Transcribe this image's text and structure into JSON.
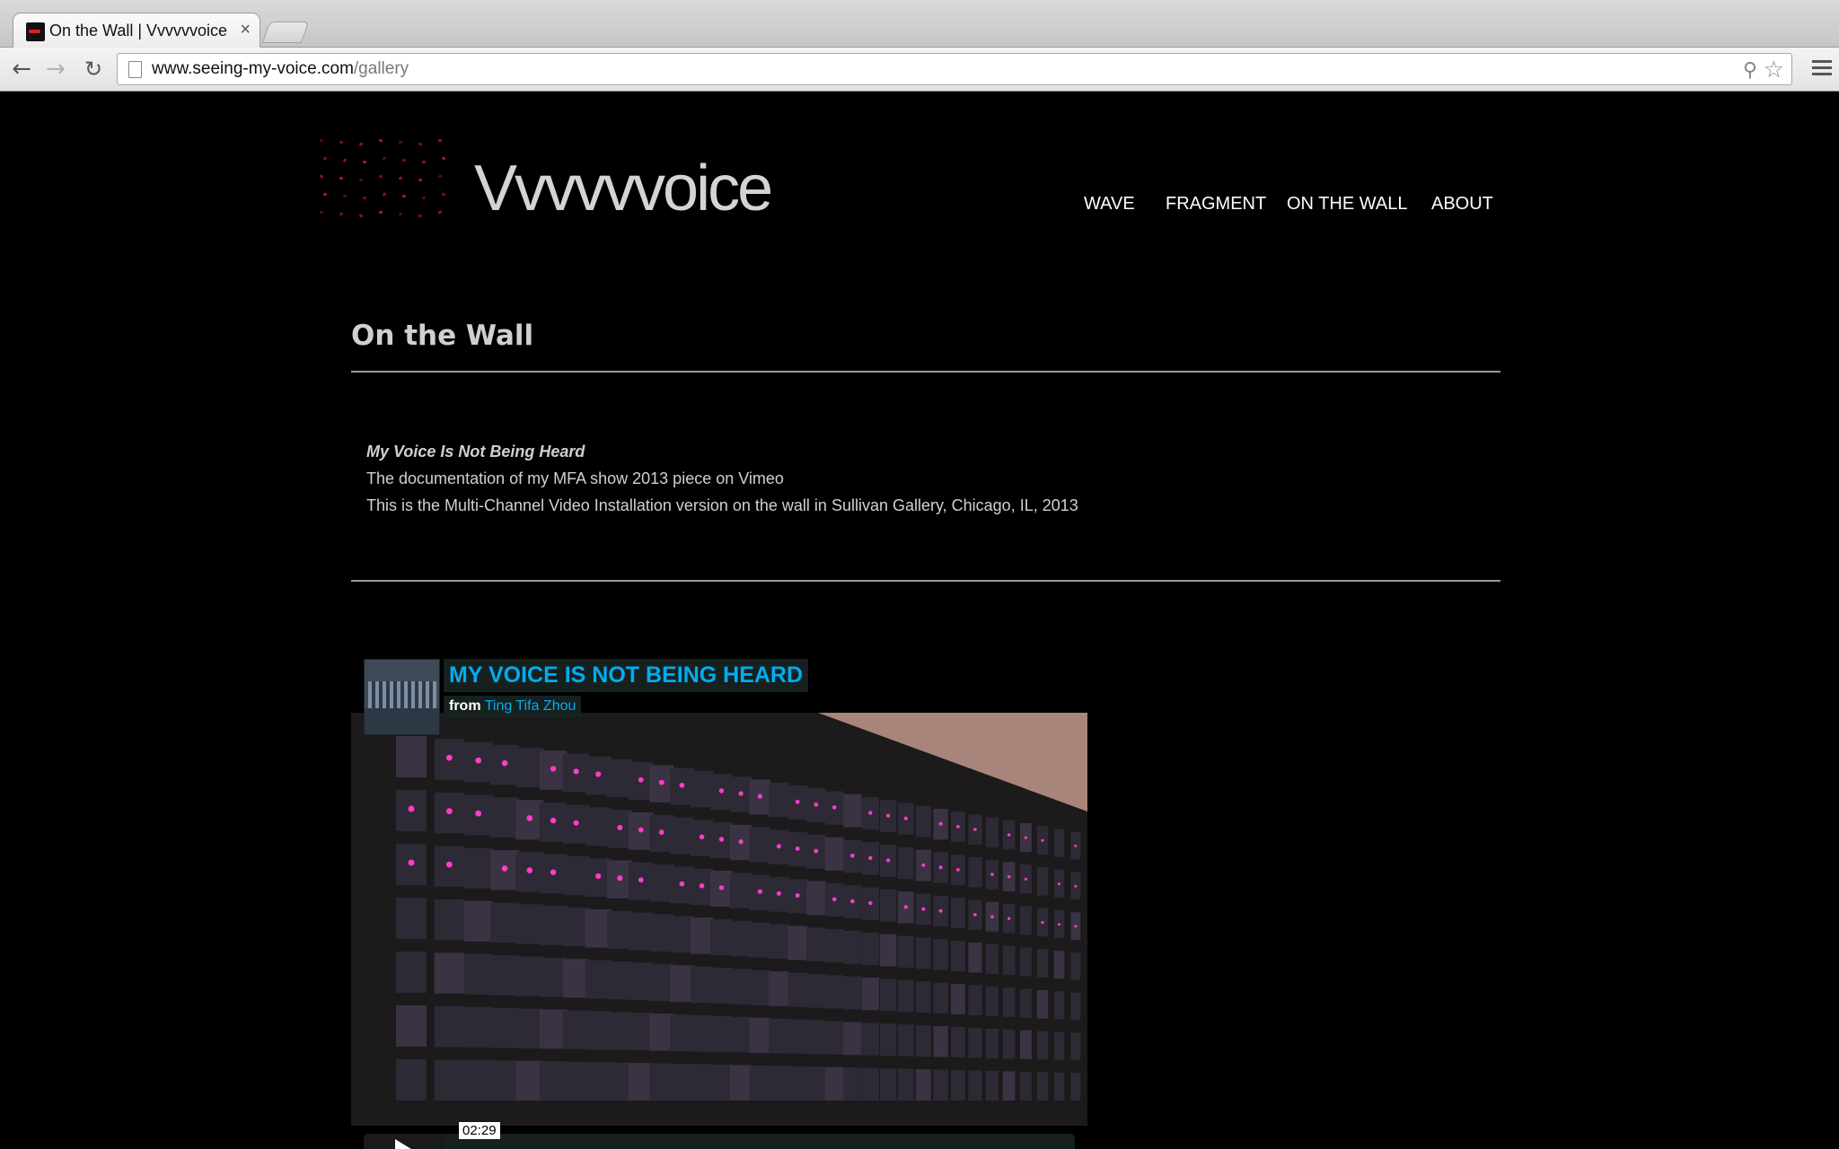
{
  "browser": {
    "tab_title": "On the Wall | Vvvvvvoice",
    "tab_close": "×",
    "url_host": "www.seeing-my-voice.com",
    "url_path": "/gallery",
    "icons": [
      "back-icon",
      "forward-icon",
      "reload-icon",
      "page-icon",
      "search-icon",
      "star-icon",
      "menu-icon"
    ]
  },
  "site": {
    "brand": "Vvvvvvoice",
    "nav": [
      "WAVE",
      "FRAGMENT",
      "ON THE WALL",
      "ABOUT"
    ]
  },
  "main": {
    "title": "On the Wall",
    "work_title": "My Voice Is Not Being Heard",
    "line1": "The documentation of my MFA show 2013 piece on Vimeo",
    "line2": "This is the Multi-Channel Video Installation version on the wall in Sullivan Gallery, Chicago, IL, 2013"
  },
  "video": {
    "title": "MY VOICE IS NOT BEING HEARD",
    "from_label": "from",
    "author": "Ting Tifa Zhou",
    "duration": "02:29",
    "accent_color": "#00adef"
  }
}
